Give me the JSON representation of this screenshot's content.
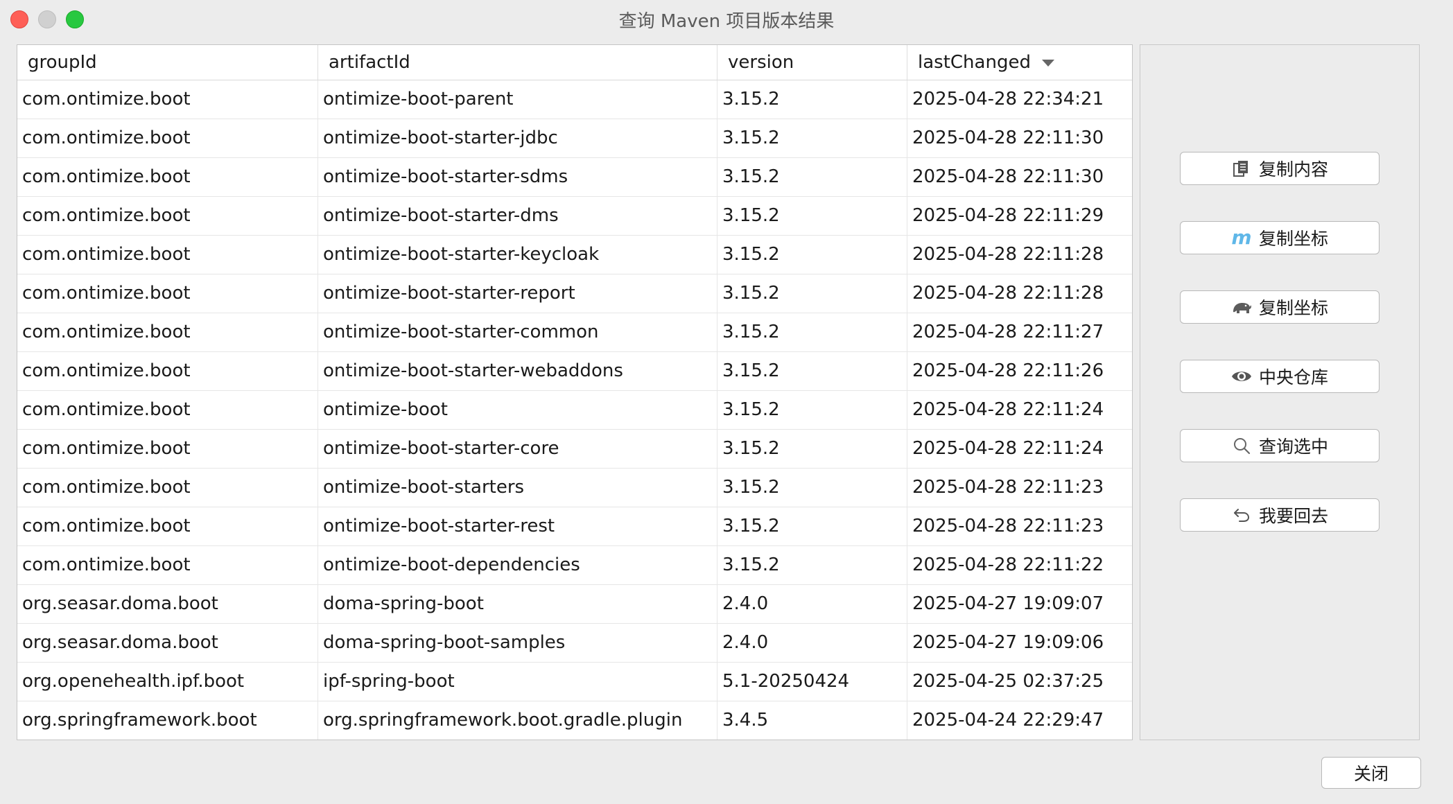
{
  "window": {
    "title": "查询 Maven 项目版本结果"
  },
  "table": {
    "columns": [
      "groupId",
      "artifactId",
      "version",
      "lastChanged"
    ],
    "sorted_column": "lastChanged",
    "sort_direction": "descending",
    "rows": [
      [
        "com.ontimize.boot",
        "ontimize-boot-parent",
        "3.15.2",
        "2025-04-28 22:34:21"
      ],
      [
        "com.ontimize.boot",
        "ontimize-boot-starter-jdbc",
        "3.15.2",
        "2025-04-28 22:11:30"
      ],
      [
        "com.ontimize.boot",
        "ontimize-boot-starter-sdms",
        "3.15.2",
        "2025-04-28 22:11:30"
      ],
      [
        "com.ontimize.boot",
        "ontimize-boot-starter-dms",
        "3.15.2",
        "2025-04-28 22:11:29"
      ],
      [
        "com.ontimize.boot",
        "ontimize-boot-starter-keycloak",
        "3.15.2",
        "2025-04-28 22:11:28"
      ],
      [
        "com.ontimize.boot",
        "ontimize-boot-starter-report",
        "3.15.2",
        "2025-04-28 22:11:28"
      ],
      [
        "com.ontimize.boot",
        "ontimize-boot-starter-common",
        "3.15.2",
        "2025-04-28 22:11:27"
      ],
      [
        "com.ontimize.boot",
        "ontimize-boot-starter-webaddons",
        "3.15.2",
        "2025-04-28 22:11:26"
      ],
      [
        "com.ontimize.boot",
        "ontimize-boot",
        "3.15.2",
        "2025-04-28 22:11:24"
      ],
      [
        "com.ontimize.boot",
        "ontimize-boot-starter-core",
        "3.15.2",
        "2025-04-28 22:11:24"
      ],
      [
        "com.ontimize.boot",
        "ontimize-boot-starters",
        "3.15.2",
        "2025-04-28 22:11:23"
      ],
      [
        "com.ontimize.boot",
        "ontimize-boot-starter-rest",
        "3.15.2",
        "2025-04-28 22:11:23"
      ],
      [
        "com.ontimize.boot",
        "ontimize-boot-dependencies",
        "3.15.2",
        "2025-04-28 22:11:22"
      ],
      [
        "org.seasar.doma.boot",
        "doma-spring-boot",
        "2.4.0",
        "2025-04-27 19:09:07"
      ],
      [
        "org.seasar.doma.boot",
        "doma-spring-boot-samples",
        "2.4.0",
        "2025-04-27 19:09:06"
      ],
      [
        "org.openehealth.ipf.boot",
        "ipf-spring-boot",
        "5.1-20250424",
        "2025-04-25 02:37:25"
      ],
      [
        "org.springframework.boot",
        "org.springframework.boot.gradle.plugin",
        "3.4.5",
        "2025-04-24 22:29:47"
      ]
    ]
  },
  "side": {
    "buttons": [
      {
        "label": "复制内容",
        "icon": "copy-icon"
      },
      {
        "label": "复制坐标",
        "icon": "maven-m-icon",
        "glyph": "m"
      },
      {
        "label": "复制坐标",
        "icon": "gradle-elephant-icon"
      },
      {
        "label": "中央仓库",
        "icon": "eye-icon"
      },
      {
        "label": "查询选中",
        "icon": "search-icon"
      },
      {
        "label": "我要回去",
        "icon": "back-arrow-icon"
      }
    ]
  },
  "footer": {
    "close_label": "关闭"
  },
  "colors": {
    "close": "#fe5f57",
    "minimize": "#d0d0d0",
    "maximize": "#28c840",
    "maven_icon": "#5fb7e8"
  }
}
